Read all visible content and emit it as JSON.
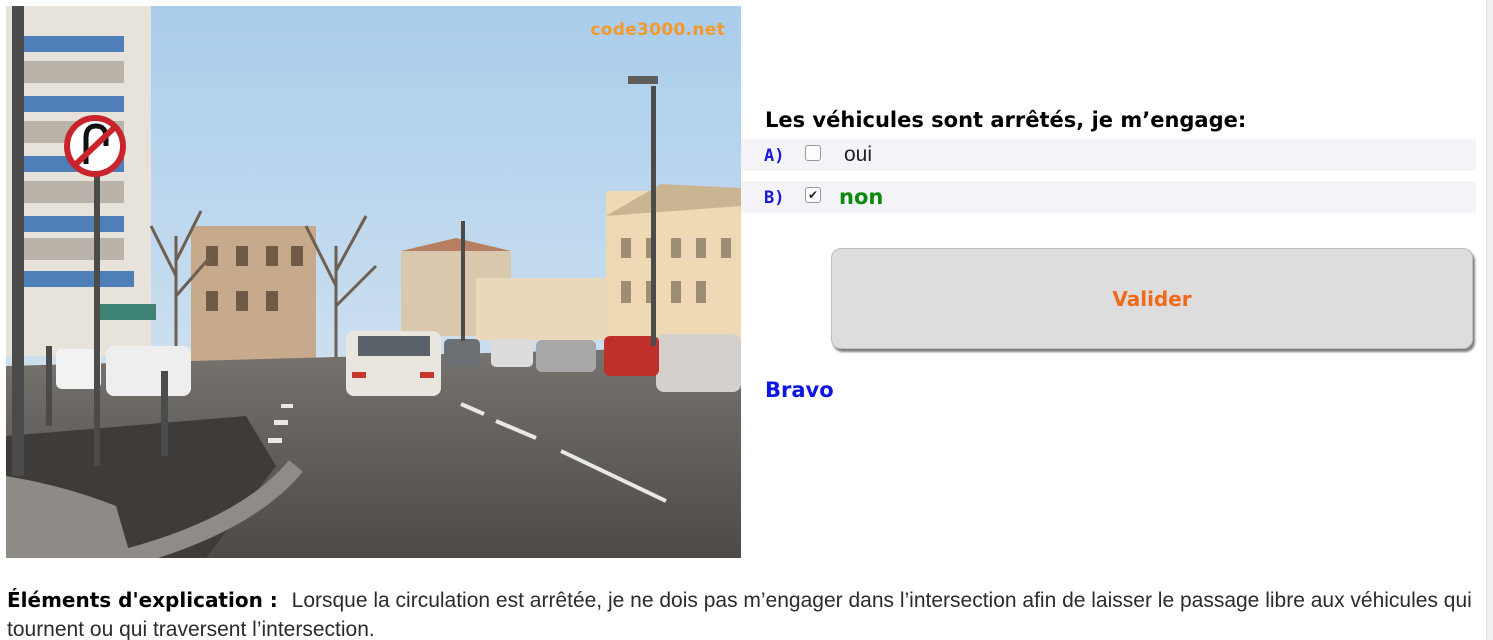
{
  "photo": {
    "watermark": "code3000.net"
  },
  "question": {
    "text": "Les véhicules sont arrêtés, je m’engage:"
  },
  "answers": [
    {
      "letter": "A)",
      "text": "oui",
      "checked": false
    },
    {
      "letter": "B)",
      "text": "non",
      "checked": true
    }
  ],
  "checkmark": "✔",
  "button": {
    "label": "Valider"
  },
  "result": {
    "text": "Bravo"
  },
  "explanation": {
    "label": "Éléments d'explication :",
    "text": "Lorsque la circulation est arrêtée, je ne dois pas m’engager dans l’intersection afin de laisser le passage libre aux véhicules qui tournent ou qui traversent l’intersection."
  },
  "colors": {
    "question_text": "#000000",
    "answer_letter": "#1818d8",
    "correct_answer": "#0b8a0b",
    "button_text": "#f06a18",
    "result_text": "#0c16e0"
  }
}
